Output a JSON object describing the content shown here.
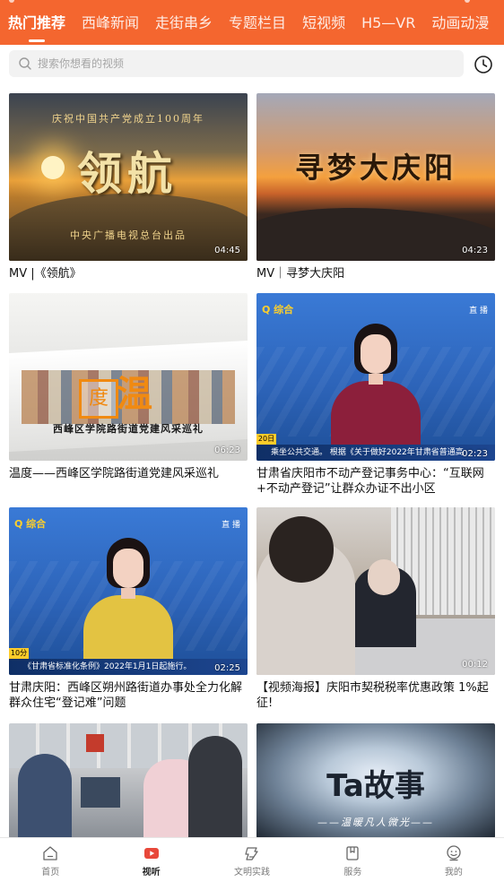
{
  "header": {
    "tabs": [
      {
        "label": "热门推荐",
        "active": true
      },
      {
        "label": "西峰新闻",
        "active": false
      },
      {
        "label": "走街串乡",
        "active": false
      },
      {
        "label": "专题栏目",
        "active": false
      },
      {
        "label": "短视频",
        "active": false
      },
      {
        "label": "H5—VR",
        "active": false
      },
      {
        "label": "动画动漫",
        "active": false
      }
    ],
    "accent_color": "#f4662f"
  },
  "search": {
    "placeholder": "搜索你想看的视频",
    "history_icon": "clock-icon"
  },
  "videos": [
    {
      "title": "MV |《领航》",
      "duration": "04:45",
      "overlay": {
        "top": "庆祝中国共产党成立100周年",
        "big": "领航",
        "bottom": "中央广播电视总台出品"
      }
    },
    {
      "title": "MV｜寻梦大庆阳",
      "duration": "04:23",
      "overlay": {
        "big": "寻梦大庆阳"
      }
    },
    {
      "title": "温度——西峰区学院路街道党建风采巡礼",
      "duration": "06:23",
      "overlay": {
        "stamp": "度",
        "big": "温",
        "sub": "西峰区学院路街道党建风采巡礼"
      }
    },
    {
      "title": "甘肃省庆阳市不动产登记事务中心：“互联网+不动产登记”让群众办证不出小区",
      "duration": "02:23",
      "overlay": {
        "logo": "Q 综合",
        "live": "直 播",
        "tag": "20日",
        "ticker": "乘坐公共交通。 根据《关于做好2022年甘肃省普通高"
      }
    },
    {
      "title": "甘肃庆阳：西峰区朔州路街道办事处全力化解群众住宅“登记难”问题",
      "duration": "02:25",
      "overlay": {
        "logo": "Q 综合",
        "live": "直 播",
        "tag": "10分",
        "ticker": "《甘肃省标准化条例》2022年1月1日起施行。"
      }
    },
    {
      "title": "【视频海报】庆阳市契税税率优惠政策 1%起征!",
      "duration": "00:12",
      "overlay": {}
    },
    {
      "title": "",
      "duration": "",
      "overlay": {}
    },
    {
      "title": "",
      "duration": "",
      "overlay": {
        "big": "Ta故事",
        "sub": "——温暖凡人微光——"
      }
    }
  ],
  "bottom_nav": [
    {
      "label": "首页",
      "icon": "home-icon",
      "active": false
    },
    {
      "label": "视听",
      "icon": "video-play-icon",
      "active": true
    },
    {
      "label": "文明实践",
      "icon": "civilization-icon",
      "active": false
    },
    {
      "label": "服务",
      "icon": "service-icon",
      "active": false
    },
    {
      "label": "我的",
      "icon": "profile-icon",
      "active": false
    }
  ],
  "colors": {
    "active_nav_icon": "#e8483a",
    "nav_text": "#7a7a7a",
    "news_gold": "#ffd02a"
  }
}
